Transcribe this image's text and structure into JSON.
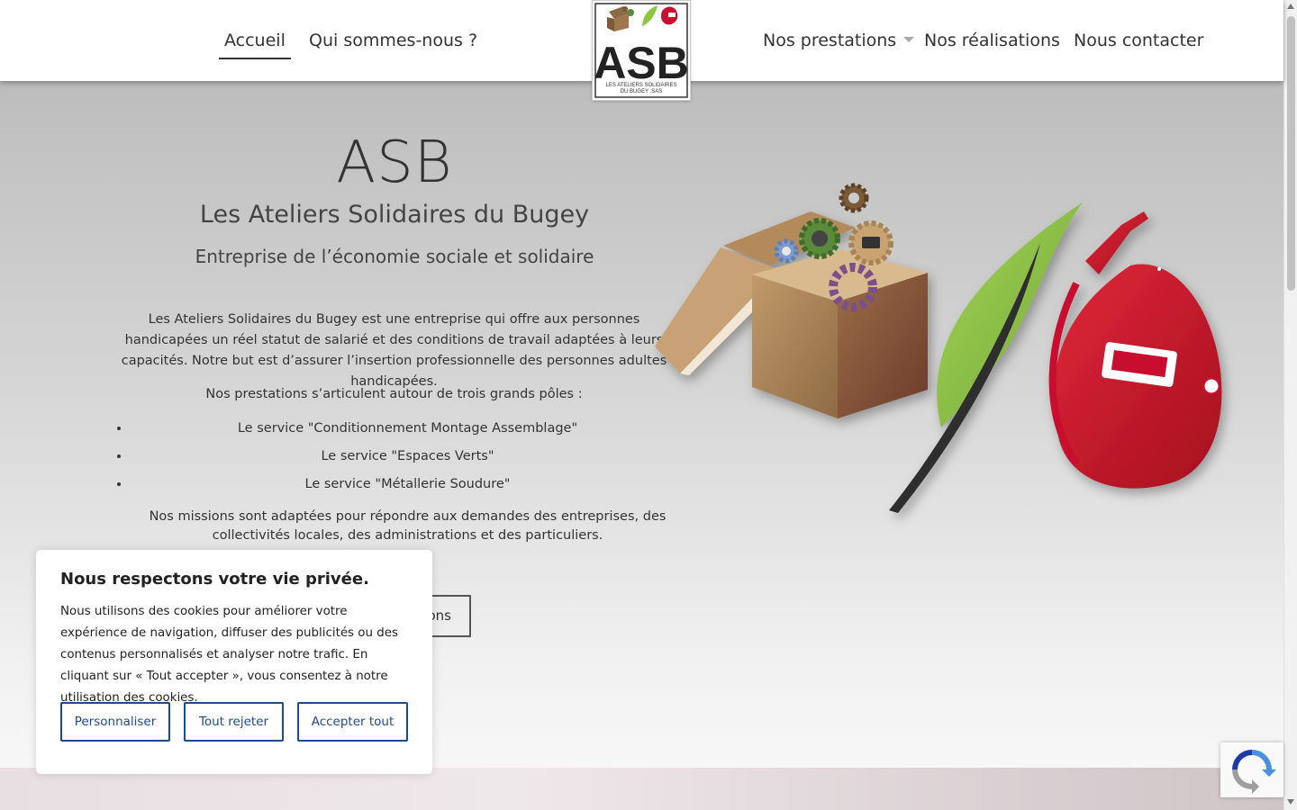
{
  "nav": {
    "left": [
      {
        "label": "Accueil",
        "active": true
      },
      {
        "label": "Qui sommes-nous ?",
        "active": false
      }
    ],
    "right": [
      {
        "label": "Nos prestations",
        "has_dropdown": true
      },
      {
        "label": "Nos réalisations",
        "has_dropdown": false
      },
      {
        "label": "Nous contacter",
        "has_dropdown": false
      }
    ],
    "logo": {
      "text": "ASB",
      "tagline_1": "LES ATELIERS SOLIDAIRES",
      "tagline_2": "DU BUGEY .SAS"
    }
  },
  "hero": {
    "title": "ASB",
    "subtitle": "Les Ateliers Solidaires du Bugey",
    "tagline": "Entreprise de l’économie sociale et solidaire",
    "intro": "Les Ateliers Solidaires du Bugey est une entreprise qui offre aux personnes handicapées un réel statut de salarié et des conditions de travail adaptées à leurs capacités. Notre but est d’assurer l’insertion professionnelle des personnes adultes handicapées.",
    "poles_intro": "Nos prestations s’articulent autour de trois grands pôles :",
    "poles": [
      "Le service \"Conditionnement Montage Assemblage\"",
      "Le service \"Espaces Verts\"",
      "Le service \"Métallerie Soudure\""
    ],
    "missions": "Nos missions sont adaptées pour répondre aux demandes des entreprises, des collectivités locales, des administrations et des particuliers.",
    "cta_visible_text": "ons"
  },
  "cookie_banner": {
    "title": "Nous respectons votre vie privée.",
    "text": "Nous utilisons des cookies pour améliorer votre expérience de navigation, diffuser des publicités ou des contenus personnalisés et analyser notre trafic. En cliquant sur « Tout accepter », vous consentez à notre utilisation des cookies.",
    "buttons": {
      "customize": "Personnaliser",
      "reject": "Tout rejeter",
      "accept": "Accepter tout"
    }
  },
  "colors": {
    "text": "#333333",
    "cookie_button": "#1d4b8f",
    "leaf_green": "#8cc63f",
    "helmet_red": "#c8102e",
    "box_brown": "#a07850"
  }
}
